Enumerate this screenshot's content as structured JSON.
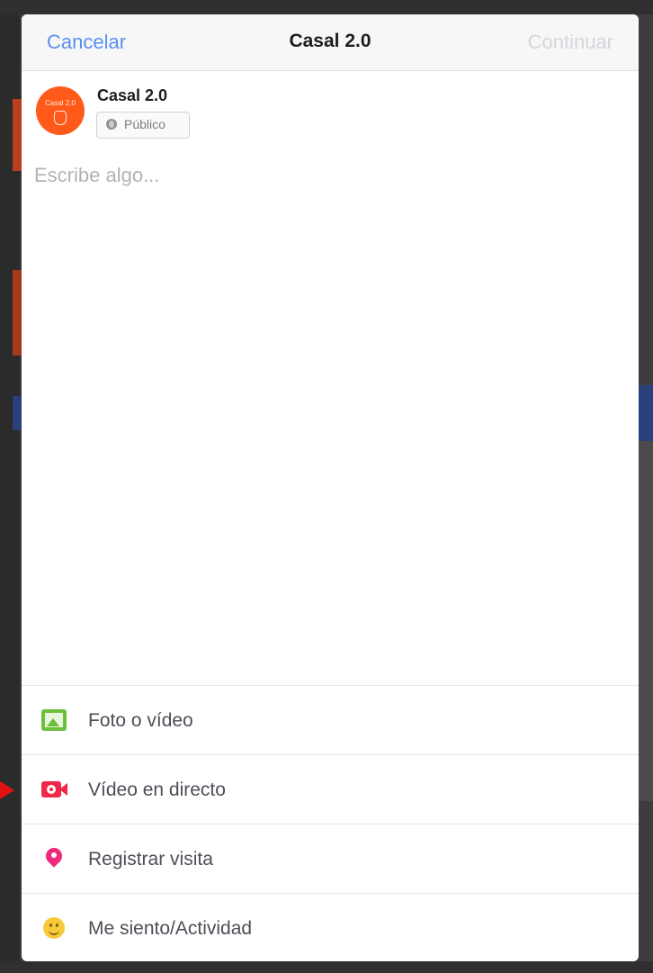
{
  "nav": {
    "cancel_label": "Cancelar",
    "title": "Casal 2.0",
    "continue_label": "Continuar"
  },
  "author": {
    "name": "Casal 2.0",
    "avatar_text": "Casal 2.0",
    "audience_label": "Público",
    "audience_icon": "globe-icon"
  },
  "composer": {
    "placeholder": "Escribe algo...",
    "value": ""
  },
  "actions": [
    {
      "label": "Foto o vídeo",
      "icon": "photo-icon",
      "color": "#6bbf3a"
    },
    {
      "label": "Vídeo en directo",
      "icon": "live-video-icon",
      "color": "#f02849"
    },
    {
      "label": "Registrar visita",
      "icon": "location-pin-icon",
      "color": "#f0287e"
    },
    {
      "label": "Me siento/Actividad",
      "icon": "smiley-icon",
      "color": "#f7c93b"
    }
  ],
  "colors": {
    "link": "#5b8ff0",
    "disabled": "#d3d6db",
    "avatar_bg": "#ff5a1a",
    "annotation_arrow": "#e0120f"
  }
}
